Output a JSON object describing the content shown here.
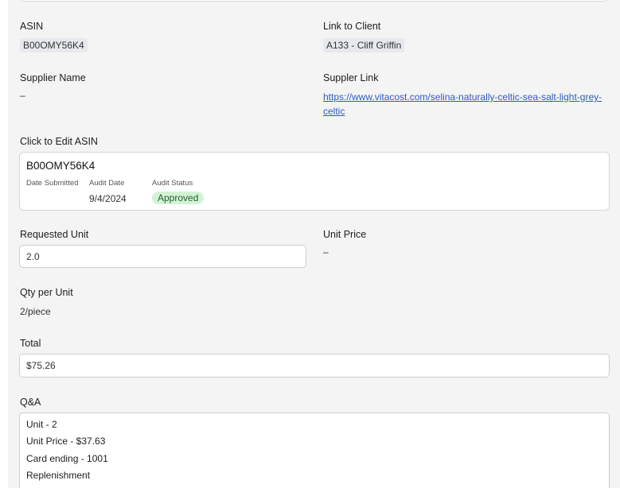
{
  "asin": {
    "label": "ASIN",
    "value": "B00OMY56K4"
  },
  "client": {
    "label": "Link to Client",
    "value": "A133 - Cliff Griffin"
  },
  "supplier": {
    "label": "Supplier Name",
    "value": "–"
  },
  "supplier_link": {
    "label": "Suppler Link",
    "url": "https://www.vitacost.com/selina-naturally-celtic-sea-salt-light-grey-celtic"
  },
  "edit_asin": {
    "label": "Click to Edit ASIN",
    "code": "B00OMY56K4",
    "date_submitted_label": "Date Submitted",
    "date_submitted_value": "",
    "audit_date_label": "Audit Date",
    "audit_date_value": "9/4/2024",
    "audit_status_label": "Audit Status",
    "audit_status_value": "Approved",
    "status_color": "#d3f3d5"
  },
  "requested_unit": {
    "label": "Requested Unit",
    "value": "2.0"
  },
  "unit_price": {
    "label": "Unit Price",
    "value": "–"
  },
  "qty_per_unit": {
    "label": "Qty per Unit",
    "value": "2/piece"
  },
  "total": {
    "label": "Total",
    "value": "$75.26"
  },
  "qa": {
    "label": "Q&A",
    "lines": [
      "Unit - 2",
      "Unit Price - $37.63",
      "Card ending - 1001",
      "Replenishment"
    ]
  },
  "colors": {
    "link": "#2e5bbd",
    "chip_bg": "#e7e9ee",
    "page_bg": "#f4f4f4"
  }
}
